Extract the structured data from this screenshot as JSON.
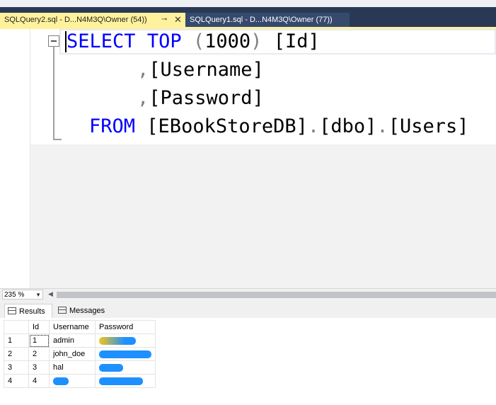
{
  "tabs": {
    "active_label": "SQLQuery2.sql - D...N4M3Q\\Owner (54))",
    "pin_glyph": "⊸",
    "close_glyph": "✕",
    "inactive_label": "SQLQuery1.sql - D...N4M3Q\\Owner (77))"
  },
  "editor": {
    "line1": {
      "select": "SELECT",
      "top": "TOP",
      "paren_open": "(",
      "number": "1000",
      "paren_close": ")",
      "col": "[Id]"
    },
    "line2": {
      "comma": ",",
      "col": "[Username]"
    },
    "line3": {
      "comma": ",",
      "col": "[Password]"
    },
    "line4": {
      "from": "FROM",
      "db": "[EBookStoreDB]",
      "dot1": ".",
      "schema": "[dbo]",
      "dot2": ".",
      "table": "[Users]"
    }
  },
  "zoom": {
    "value": "235 %"
  },
  "results_tabs": {
    "results": "Results",
    "messages": "Messages"
  },
  "grid": {
    "columns": [
      "Id",
      "Username",
      "Password"
    ],
    "rows": [
      {
        "row": "1",
        "id": "1",
        "username": "admin",
        "password_redacted": true
      },
      {
        "row": "2",
        "id": "2",
        "username": "john_doe",
        "password_redacted": true
      },
      {
        "row": "3",
        "id": "3",
        "username": "hal",
        "password_redacted": true
      },
      {
        "row": "4",
        "id": "4",
        "username_redacted": true,
        "password_redacted": true
      }
    ]
  },
  "colors": {
    "active_tab": "#fff29d",
    "tab_bar": "#293955",
    "keyword": "#0000ff",
    "redaction": "#1e90ff"
  }
}
